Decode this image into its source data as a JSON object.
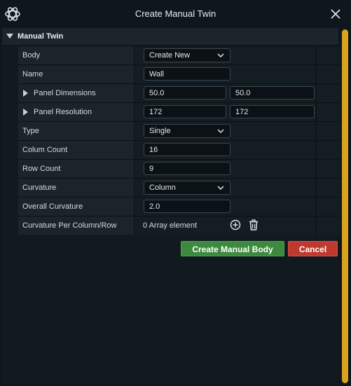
{
  "window": {
    "title": "Create Manual Twin"
  },
  "section": {
    "label": "Manual Twin"
  },
  "rows": {
    "body": {
      "label": "Body",
      "value": "Create New"
    },
    "name": {
      "label": "Name",
      "value": "Wall"
    },
    "panel_dimensions": {
      "label": "Panel Dimensions",
      "value1": "50.0",
      "value2": "50.0"
    },
    "panel_resolution": {
      "label": "Panel Resolution",
      "value1": "172",
      "value2": "172"
    },
    "type": {
      "label": "Type",
      "value": "Single"
    },
    "colum_count": {
      "label": "Colum Count",
      "value": "16"
    },
    "row_count": {
      "label": "Row Count",
      "value": "9"
    },
    "curvature": {
      "label": "Curvature",
      "value": "Column"
    },
    "overall_curvature": {
      "label": "Overall Curvature",
      "value": "2.0"
    },
    "curvature_per": {
      "label": "Curvature Per Column/Row",
      "value": "0 Array element"
    }
  },
  "buttons": {
    "create": "Create Manual Body",
    "cancel": "Cancel"
  },
  "colors": {
    "accent_scroll": "#d9a21f",
    "primary": "#3c8a3e",
    "danger": "#c0392f"
  }
}
